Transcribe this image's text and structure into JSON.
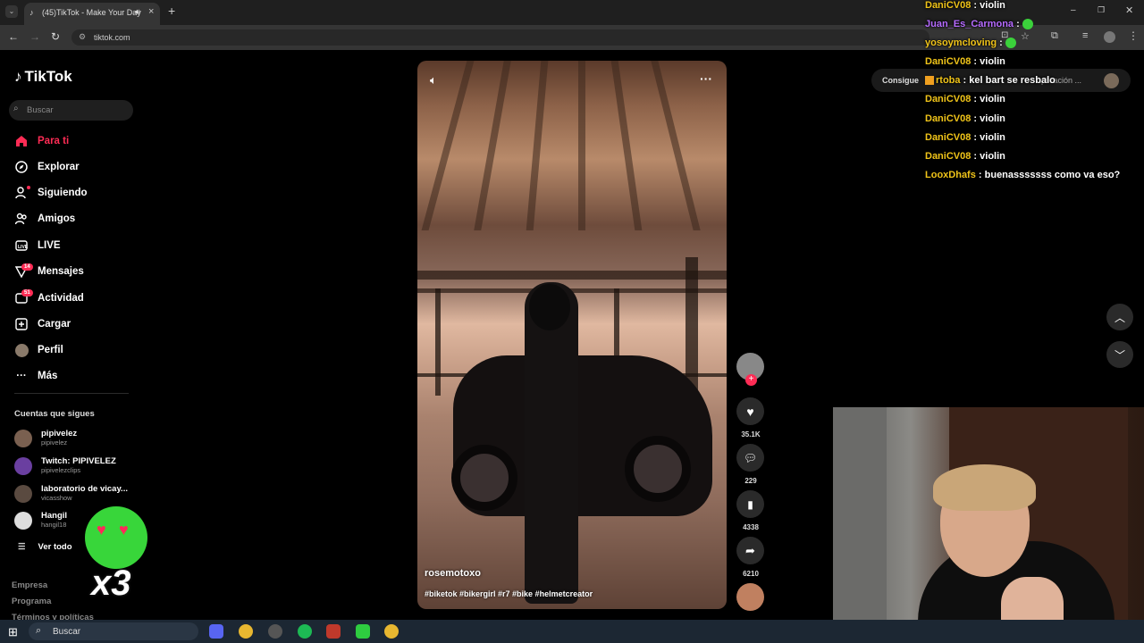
{
  "browser": {
    "tab_title": "(45)TikTok - Make Your Day",
    "url": "tiktok.com",
    "consigue_label": "Consigue",
    "aplicacion_label": "Aplicación ..."
  },
  "sidebar": {
    "logo": "TikTok",
    "search_placeholder": "Buscar",
    "nav": [
      {
        "label": "Para ti",
        "icon": "home-icon"
      },
      {
        "label": "Explorar",
        "icon": "compass-icon"
      },
      {
        "label": "Siguiendo",
        "icon": "following-icon"
      },
      {
        "label": "Amigos",
        "icon": "friends-icon"
      },
      {
        "label": "LIVE",
        "icon": "live-icon"
      },
      {
        "label": "Mensajes",
        "icon": "messages-icon",
        "badge": "14"
      },
      {
        "label": "Actividad",
        "icon": "activity-icon",
        "badge": "51"
      },
      {
        "label": "Cargar",
        "icon": "upload-icon"
      },
      {
        "label": "Perfil",
        "icon": "profile-icon"
      },
      {
        "label": "Más",
        "icon": "more-icon"
      }
    ],
    "following_title": "Cuentas que sigues",
    "following": [
      {
        "name": "pipivelez",
        "handle": "pipivelez"
      },
      {
        "name": "Twitch: PIPIVELEZ",
        "handle": "pipivelezclips"
      },
      {
        "name": "laboratorio de vicay...",
        "handle": "vicasshow"
      },
      {
        "name": "Hangil",
        "handle": "hangil18"
      }
    ],
    "see_all": "Ver todo",
    "footer": [
      "Empresa",
      "Programa",
      "Términos y políticas"
    ]
  },
  "video": {
    "author": "rosemotoxo",
    "caption": "#biketok #bikergirl #r7 #bike #helmetcreator",
    "likes": "35.1K",
    "comments": "229",
    "saves": "4338",
    "shares": "6210"
  },
  "sticker_text": "x3",
  "chat": [
    {
      "user": "DaniCV08",
      "msg": "violin",
      "color": "#f0c419"
    },
    {
      "user": "Juan_Es_Carmona",
      "msg": "",
      "color": "#b66bff"
    },
    {
      "user": "yosoymcloving",
      "msg": "",
      "color": "#f0c419"
    },
    {
      "user": "DaniCV08",
      "msg": "violin",
      "color": "#f0c419"
    },
    {
      "user": "rtoba",
      "msg": "kel bart se resbalo",
      "color": "#f0c419"
    },
    {
      "user": "DaniCV08",
      "msg": "violin",
      "color": "#f0c419"
    },
    {
      "user": "DaniCV08",
      "msg": "violin",
      "color": "#f0c419"
    },
    {
      "user": "DaniCV08",
      "msg": "violin",
      "color": "#f0c419"
    },
    {
      "user": "DaniCV08",
      "msg": "violin",
      "color": "#f0c419"
    },
    {
      "user": "LooxDhafs",
      "msg": "buenasssssss como va eso?",
      "color": "#f0c419"
    }
  ],
  "taskbar": {
    "search_label": "Buscar"
  },
  "colors": {
    "accent": "#fe2c55",
    "chat_name": "#f0c419",
    "chat_name_alt": "#b66bff"
  }
}
